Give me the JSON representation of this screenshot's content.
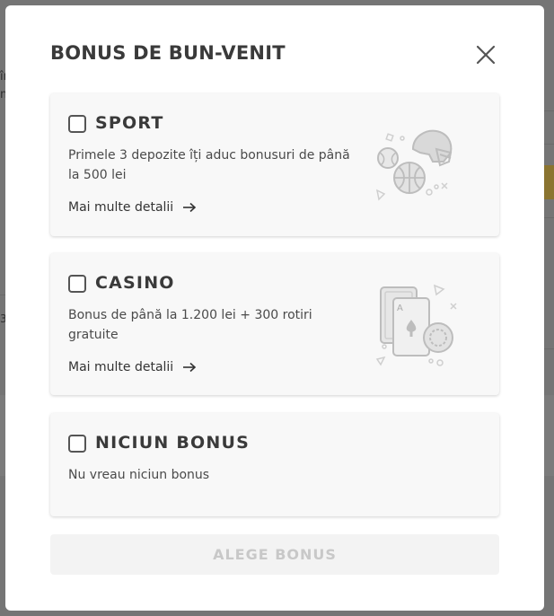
{
  "background": {
    "fragments": [
      "în",
      "m",
      "3"
    ]
  },
  "modal": {
    "title": "BONUS DE BUN-VENIT",
    "close_icon": "close-icon"
  },
  "options": [
    {
      "id": "sport",
      "title": "SPORT",
      "description": "Primele 3 depozite îți aduc bonusuri de până la 500 lei",
      "link": "Mai multe detalii",
      "icon": "sports-balls-icon",
      "checked": false
    },
    {
      "id": "casino",
      "title": "CASINO",
      "description": "Bonus de până la 1.200 lei + 300 rotiri gratuite",
      "link": "Mai multe detalii",
      "icon": "casino-cards-chip-icon",
      "checked": false
    },
    {
      "id": "none",
      "title": "NICIUN BONUS",
      "description": "Nu vreau niciun bonus",
      "checked": false
    }
  ],
  "action": {
    "label": "ALEGE BONUS",
    "disabled": true
  },
  "colors": {
    "overlay": "#757575",
    "title_text": "#3a3a3a",
    "card_bg": "#f8f8f8",
    "button_disabled_bg": "#f3f3f3",
    "button_disabled_text": "#c8c8c8"
  }
}
